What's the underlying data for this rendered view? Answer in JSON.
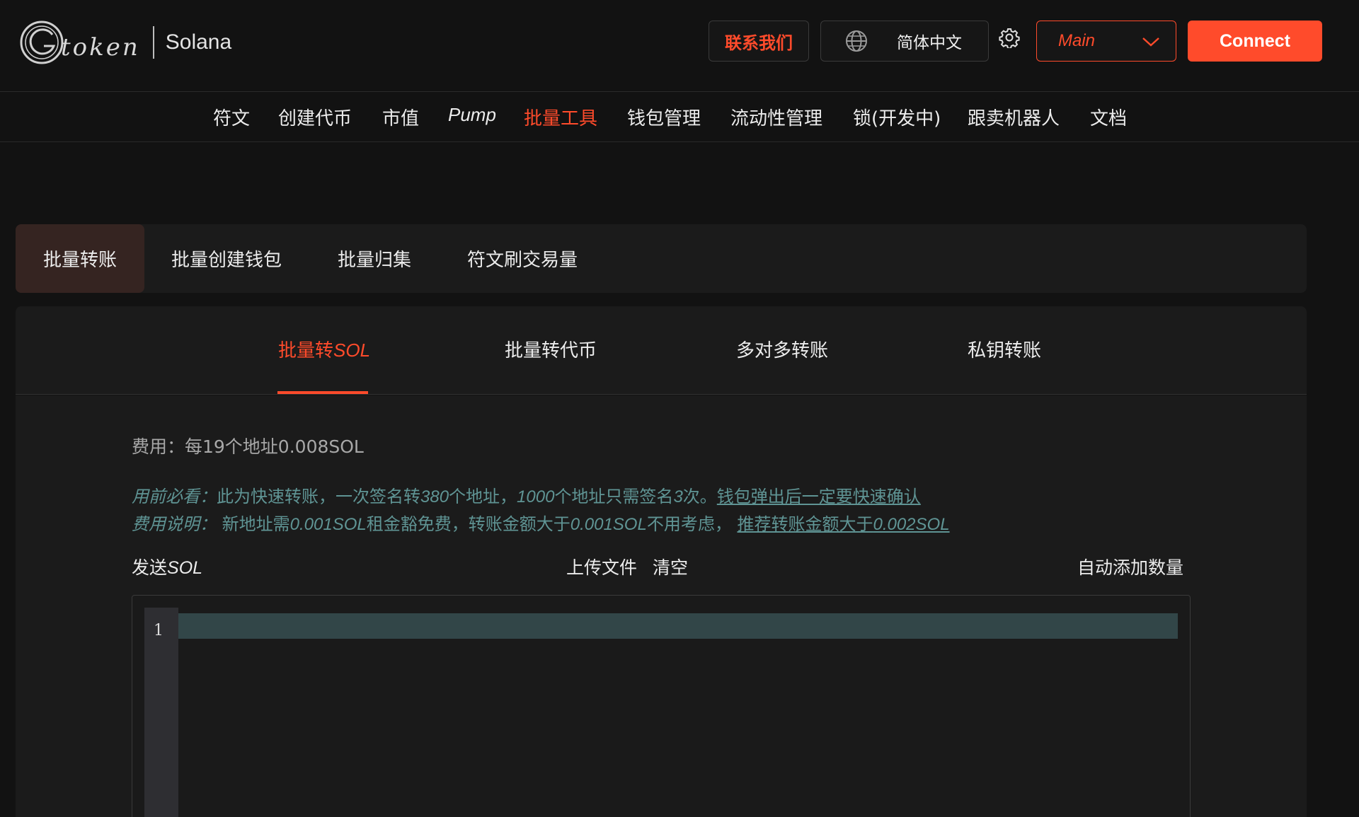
{
  "header": {
    "logo_word": "token",
    "chain": "Solana",
    "contact_label": "联系我们",
    "language_label": "简体中文",
    "network_label": "Main",
    "connect_label": "Connect"
  },
  "nav": {
    "items": [
      "符文",
      "创建代币",
      "市值",
      "Pump",
      "批量工具",
      "钱包管理",
      "流动性管理",
      "锁(开发中)",
      "跟卖机器人",
      "文档"
    ],
    "active": "批量工具"
  },
  "tabs": {
    "items": [
      "批量转账",
      "批量创建钱包",
      "批量归集",
      "符文刷交易量"
    ],
    "active": "批量转账"
  },
  "subtabs": {
    "sol_prefix": "批量转",
    "sol_suffix": "SOL",
    "token": "批量转代币",
    "many": "多对多转账",
    "privkey": "私钥转账"
  },
  "content": {
    "fee": "费用：每19个地址0.008SOL",
    "notice1": {
      "label": "用前必看：",
      "t1": "此为快速转账，一次签名转",
      "n1": "380",
      "t2": "个地址，",
      "n2": "1000",
      "t3": "个地址只需签名",
      "n3": "3",
      "t4": "次。",
      "link": "钱包弹出后一定要快速确认"
    },
    "notice2": {
      "label": "费用说明：",
      "t1": " 新地址需",
      "v1": "0.001SOL",
      "t2": "租金豁免费，转账金额大于",
      "v2": "0.001SOL",
      "t3": "不用考虑， ",
      "link_prefix": "推荐转账金额大于",
      "link_value": "0.002SOL"
    },
    "send_prefix": "发送",
    "send_suffix": "SOL",
    "upload": "上传文件",
    "clear": "清空",
    "auto_add": "自动添加数量",
    "editor_line": "1"
  },
  "colors": {
    "accent": "#ff4b2b",
    "notice": "#5f9494",
    "background": "#121212",
    "panel": "#1b1b1b"
  },
  "icons": [
    "logo-g-icon",
    "globe-icon",
    "gear-icon",
    "chevron-down-icon"
  ]
}
